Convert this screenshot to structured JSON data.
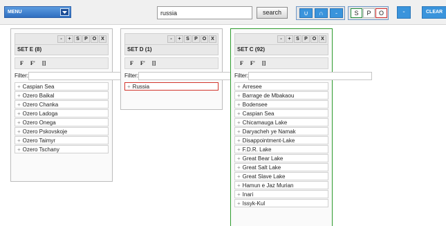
{
  "toolbar": {
    "menu_label": "MENU",
    "search_value": "russia",
    "search_button": "search",
    "set_ops": [
      "∪",
      "∩",
      "-"
    ],
    "spo": [
      "S",
      "P",
      "O"
    ],
    "minus_label": "-",
    "clear_label": "CLEAR"
  },
  "panel_controls": [
    "-",
    "+",
    "S",
    "P",
    "O",
    "X"
  ],
  "view_buttons": [
    "F",
    "F'",
    "[]"
  ],
  "filter_label": "Filter:",
  "sets": [
    {
      "title": "SET E (8)",
      "items": [
        "Caspian Sea",
        "Ozero Baikal",
        "Ozero Chanka",
        "Ozero Ladoga",
        "Ozero Onega",
        "Ozero Pskovskoje",
        "Ozero Taimyr",
        "Ozero Tschany"
      ]
    },
    {
      "title": "SET D (1)",
      "items": [
        "Russia"
      ],
      "selected_item": "Russia"
    },
    {
      "title": "SET C (92)",
      "active": true,
      "items": [
        "Arresee",
        "Barrage de Mbakaou",
        "Bodensee",
        "Caspian Sea",
        "Chicamauga Lake",
        "Daryacheh ye Namak",
        "Disappointment-Lake",
        "F.D.R. Lake",
        "Great Bear Lake",
        "Great Salt Lake",
        "Great Slave Lake",
        "Hamun e Jaz Murian",
        "Inari",
        "Issyk-Kul"
      ]
    }
  ],
  "colors": {
    "accent_blue": "#3a94dc",
    "menu_blue": "#2f6fc0",
    "active_set_border": "#2c9a2c",
    "selected_item_border": "#d2342b"
  },
  "icons": {
    "menu_dropdown": "chevron-down-icon",
    "list_item_marker": "plus-icon"
  }
}
